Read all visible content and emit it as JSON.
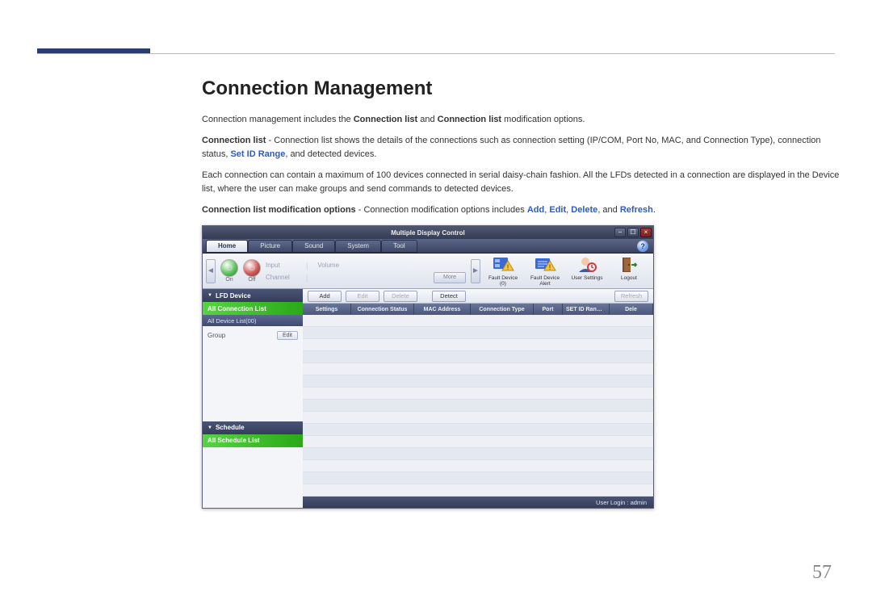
{
  "page": {
    "number": "57",
    "heading": "Connection Management"
  },
  "para1": {
    "t1": "Connection management includes the ",
    "b1": "Connection list",
    "t2": " and ",
    "b2": "Connection list",
    "t3": " modification options."
  },
  "para2": {
    "b1": "Connection list",
    "t1": " - Connection list shows the details of the connections such as connection setting (IP/COM, Port No, MAC, and Connection Type), connection status, ",
    "a1": "Set ID Range",
    "t2": ", and detected devices."
  },
  "para3": {
    "t1": "Each connection can contain a maximum of 100 devices connected in serial daisy-chain fashion. All the LFDs detected in a connection are displayed in the Device list, where the user can make groups and send commands to detected devices."
  },
  "para4": {
    "b1": "Connection list modification options",
    "t1": " - Connection modification options includes ",
    "a1": "Add",
    "c1": ", ",
    "a2": "Edit",
    "c2": ", ",
    "a3": "Delete",
    "c3": ", and ",
    "a4": "Refresh",
    "t2": "."
  },
  "app": {
    "title": "Multiple Display Control",
    "menus": [
      "Home",
      "Picture",
      "Sound",
      "System",
      "Tool"
    ],
    "help": "?",
    "ribbon": {
      "leftArrow": "◄",
      "rightArrow": "►",
      "input": "Input",
      "channel": "Channel",
      "volume": "Volume",
      "more": "More",
      "on": "On",
      "off": "Off",
      "items": [
        {
          "icon": "⚠",
          "icon2": "▦",
          "label": "Fault Device (0)"
        },
        {
          "icon": "⚠",
          "icon2": "▦",
          "label": "Fault Device Alert"
        },
        {
          "icon": "👤",
          "label": "User Settings"
        },
        {
          "icon": "🚪",
          "label": "Logout"
        }
      ]
    },
    "sidebar": {
      "lfd": "LFD Device",
      "allconn": "All Connection List",
      "alldev": "All Device List(00)",
      "group": "Group",
      "edit": "Edit",
      "schedule": "Schedule",
      "allsched": "All Schedule List"
    },
    "toolbar": {
      "add": "Add",
      "edit": "Edit",
      "delete": "Delete",
      "detect": "Detect",
      "refresh": "Refresh"
    },
    "columns": {
      "settings": "Settings",
      "status": "Connection Status",
      "mac": "MAC Address",
      "ctype": "Connection Type",
      "port": "Port",
      "sid": "SET ID Ran…",
      "dele": "Dele"
    },
    "status": "User Login : admin",
    "rows": 15
  }
}
